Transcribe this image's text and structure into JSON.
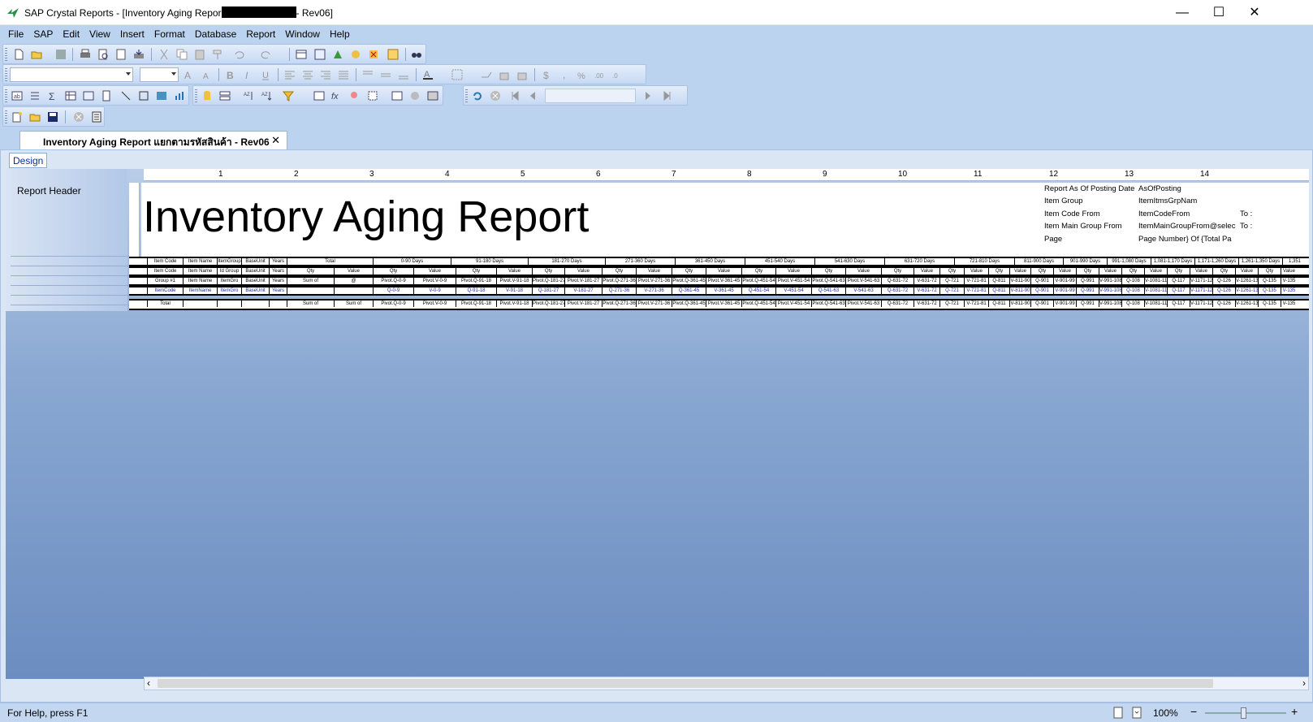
{
  "window": {
    "title_prefix": "SAP Crystal Reports - [Inventory Aging Repor",
    "title_suffix": "- Rev06]"
  },
  "window_controls": {
    "minimize": "—",
    "maximize": "☐",
    "close": "✕"
  },
  "menu": [
    "File",
    "SAP",
    "Edit",
    "View",
    "Insert",
    "Format",
    "Database",
    "Report",
    "Window",
    "Help"
  ],
  "document_tab": {
    "label": "Inventory Aging Report แยกตามรหัสสินค้า - Rev06",
    "close": "✕"
  },
  "view_tab": "Design",
  "sections": [
    "Report Header"
  ],
  "ruler_numbers": [
    "1",
    "2",
    "3",
    "4",
    "5",
    "6",
    "7",
    "8",
    "9",
    "10",
    "11",
    "12",
    "13",
    "14"
  ],
  "report": {
    "title": "Inventory Aging Report",
    "params": [
      {
        "label": "Report As Of Posting Date",
        "field": "AsOfPosting",
        "extra": ""
      },
      {
        "label": "Item Group",
        "field": "ItemItmsGrpNam",
        "extra": ""
      },
      {
        "label": "Item Code From",
        "field": "ItemCodeFrom",
        "extra": "To :"
      },
      {
        "label": "Item Main Group From",
        "field": "ItemMainGroupFrom@selec",
        "extra": "To :"
      },
      {
        "label": "Page",
        "field": "Page Number} Of {Total Pa",
        "extra": ""
      }
    ]
  },
  "bands": {
    "header1": [
      "Item Code",
      "Item Name",
      "ItemGroup",
      "BaseUnit",
      "Years",
      "Total",
      "0-90 Days",
      "91-180 Days",
      "181-270 Days",
      "271-360 Days",
      "361-450 Days",
      "451-540 Days",
      "541-630 Days",
      "631-720 Days",
      "721-810 Days",
      "811-900 Days",
      "901-990 Days",
      "991-1,080 Days",
      "1,081-1,170 Days",
      "1,171-1,260 Days",
      "1,261-1,350 Days",
      "1,351"
    ],
    "header2": [
      "Item Code",
      "Item Name",
      "Id Group",
      "BaseUnit",
      "Years",
      "Qty",
      "Value",
      "Qty",
      "Value",
      "Qty",
      "Value",
      "Qty",
      "Value",
      "Qty",
      "Value",
      "Qty",
      "Value",
      "Qty",
      "Value",
      "Qty",
      "Value",
      "Qty",
      "Value",
      "Qty",
      "Value",
      "Qty",
      "Value",
      "Qty",
      "Value",
      "Qty",
      "Value",
      "Qty",
      "Value",
      "Qty",
      "Value",
      "Qty",
      "Value",
      "Qty",
      "Value"
    ],
    "group": [
      "Group #1",
      "Item Name",
      "ItemGro",
      "BaseUnit",
      "Years",
      "Sum of",
      "@",
      "Pivot.Q-0-9",
      "Pivot.V-0-9",
      "Pivot.Q-91-18",
      "Pivot.V-91-18",
      "Pivot.Q-181-27",
      "Pivot.V-181-27",
      "Pivot.Q-271-36",
      "Pivot.V-271-36",
      "Pivot.Q-361-45",
      "Pivot.V-361-45",
      "Pivot.Q-451-54",
      "Pivot.V-451-54",
      "Pivot.Q-541-63",
      "Pivot.V-541-63",
      "Q-631-72",
      "V-631-72",
      "Q-721",
      "V-721-81",
      "Q-811",
      "V-811-90",
      "Q-901",
      "V-901-99",
      "Q-991",
      "V-991-108",
      "Q-108",
      "V-1081-117",
      "Q-117",
      "V-1171-126",
      "Q-126",
      "V-1261-135",
      "Q-135",
      "V-135"
    ],
    "details": [
      "ItemCode",
      "ItemName",
      "ItemGro",
      "BaseUnit",
      "Years",
      "",
      "",
      "Q-0-9",
      "V-0-9",
      "Q-91-18",
      "V-91-18",
      "Q-181-27",
      "V-181-27",
      "Q-271-36",
      "V-271-36",
      "Q-361-45",
      "V-361-45",
      "Q-451-54",
      "V-451-54",
      "Q-541-63",
      "V-541-63",
      "Q-631-72",
      "V-631-72",
      "Q-721",
      "V-721-81",
      "Q-811",
      "V-811-90",
      "Q-901",
      "V-901-99",
      "Q-991",
      "V-991-108",
      "Q-108",
      "V-1081-117",
      "Q-117",
      "V-1171-126",
      "Q-126",
      "V-1261-135",
      "Q-135",
      "V-135"
    ],
    "footer": [
      "Total",
      "",
      "",
      "",
      "",
      "Sum of",
      "Sum of",
      "Pivot.Q-0-9",
      "Pivot.V-0-9",
      "Pivot.Q-91-18",
      "Pivot.V-91-18",
      "Pivot.Q-181-27",
      "Pivot.V-181-27",
      "Pivot.Q-271-36",
      "Pivot.V-271-36",
      "Pivot.Q-361-45",
      "Pivot.V-361-45",
      "Pivot.Q-451-54",
      "Pivot.V-451-54",
      "Pivot.Q-541-63",
      "Pivot.V-541-63",
      "Q-631-72",
      "V-631-72",
      "Q-721",
      "V-721-81",
      "Q-811",
      "V-811-90",
      "Q-901",
      "V-901-99",
      "Q-991",
      "V-991-108",
      "Q-108",
      "V-1081-117",
      "Q-117",
      "V-1171-126",
      "Q-126",
      "V-1261-135",
      "Q-135",
      "V-135"
    ]
  },
  "statusbar": {
    "help": "For Help, press F1",
    "zoom": "100%",
    "zoom_minus": "−",
    "zoom_plus": "+"
  },
  "scroll": {
    "left": "‹",
    "right": "›"
  }
}
